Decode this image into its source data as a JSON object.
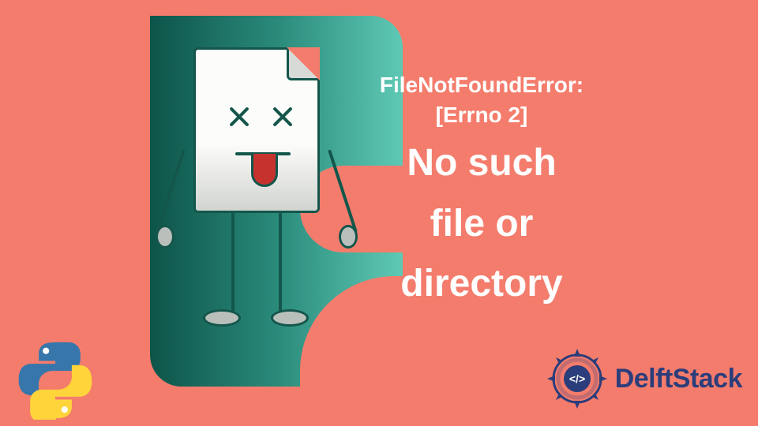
{
  "error": {
    "line1": "FileNotFoundError:",
    "line2": "[Errno 2]",
    "big1": "No such",
    "big2": "file or",
    "big3": "directory"
  },
  "brand": {
    "name": "DelftStack"
  },
  "icons": {
    "python": "python-logo",
    "delft": "delftstack-logo",
    "file_character": "sad-file"
  },
  "colors": {
    "background": "#f47c6c",
    "teal_dark": "#0d5449",
    "teal_light": "#5fc9b5",
    "text": "#ffffff",
    "brand_blue": "#2b3d7b"
  }
}
